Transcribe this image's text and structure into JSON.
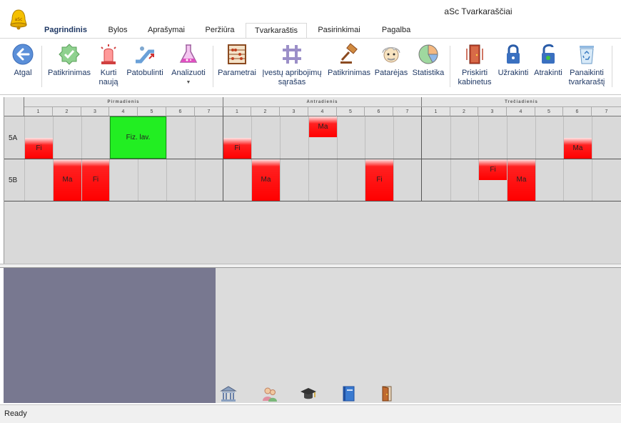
{
  "window": {
    "title": "aSc Tvarkaraščiai"
  },
  "tabs": [
    {
      "label": "Pagrindinis",
      "bold": true,
      "active": false
    },
    {
      "label": "Bylos"
    },
    {
      "label": "Aprašymai"
    },
    {
      "label": "Peržiūra"
    },
    {
      "label": "Tvarkaraštis",
      "active": true
    },
    {
      "label": "Pasirinkimai"
    },
    {
      "label": "Pagalba"
    }
  ],
  "ribbon": {
    "back": "Atgal",
    "check": "Patikrinimas",
    "create_new_line1": "Kurti",
    "create_new_line2": "naują",
    "improve": "Patobulinti",
    "analyze": "Analizuoti",
    "parameters": "Parametrai",
    "constraints_line1": "Įvestų apribojimų",
    "constraints_line2": "sąrašas",
    "check2": "Patikrinimas",
    "advisor": "Patarėjas",
    "statistics": "Statistika",
    "assign_rooms_line1": "Priskirti",
    "assign_rooms_line2": "kabinetus",
    "lock": "Užrakinti",
    "unlock": "Atrakinti",
    "delete_line1": "Panaikinti",
    "delete_line2": "tvarkaraštį"
  },
  "days": [
    "Pirmadienis",
    "Antradienis",
    "Trečiadienis"
  ],
  "periods": [
    "1",
    "2",
    "3",
    "4",
    "5",
    "6",
    "7"
  ],
  "classes": [
    "5A",
    "5B"
  ],
  "lessons": {
    "l1": "Fi",
    "l2": "Fiz. lav.",
    "l3": "Fi",
    "l4": "Ma",
    "l5": "Ma",
    "l6": "Ma",
    "l7": "Fi",
    "l8": "Ma",
    "l9": "Fi",
    "l10": "Fi",
    "l11": "Ma"
  },
  "status": {
    "text": "Ready"
  },
  "colors": {
    "lesson": "#ff0000",
    "lesson_double": "#22ee22",
    "left_pane": "#787890"
  }
}
